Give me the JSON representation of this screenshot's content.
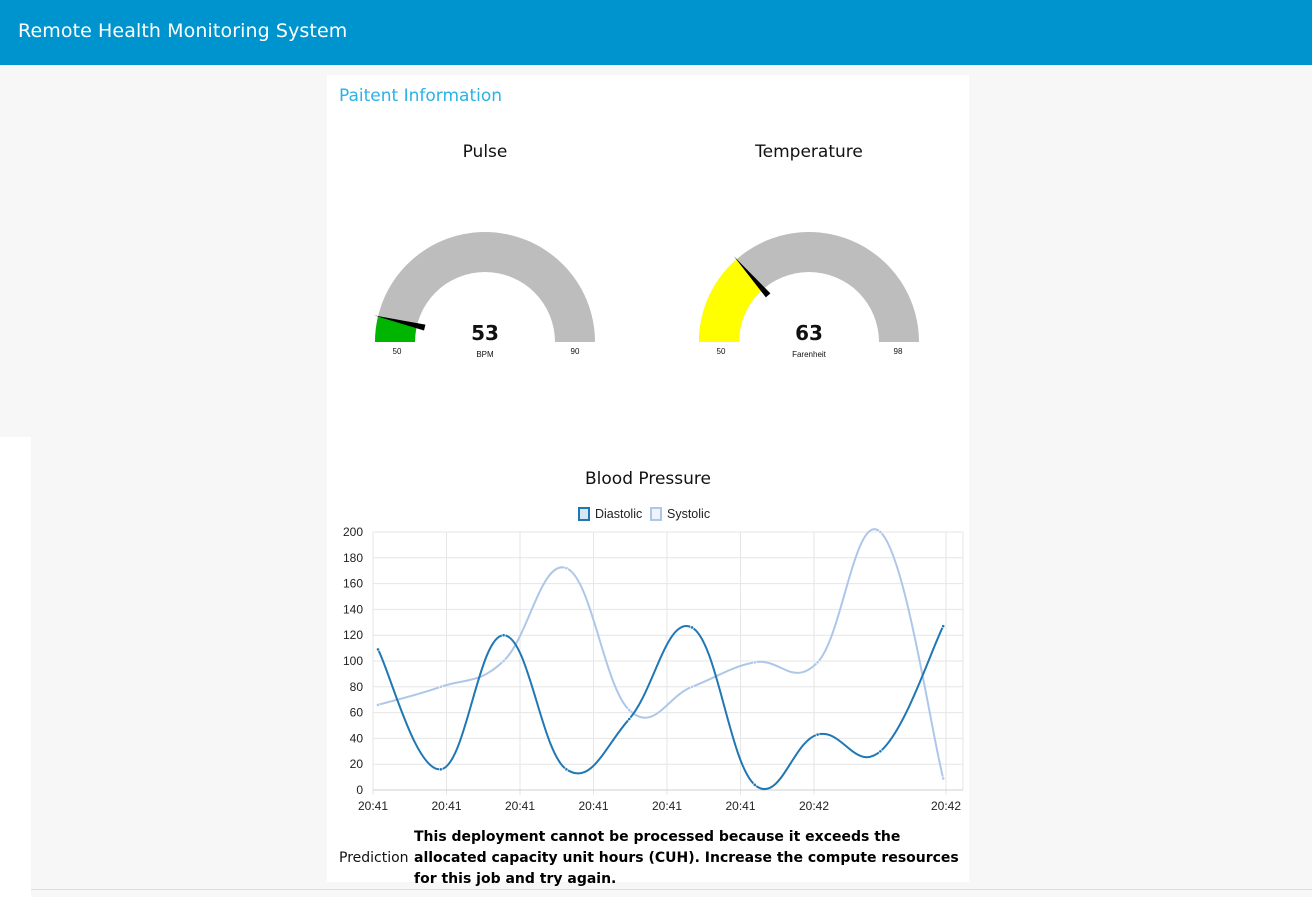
{
  "header": {
    "title": "Remote Health Monitoring System"
  },
  "card": {
    "title": "Paitent Information"
  },
  "gauges": [
    {
      "label": "Pulse",
      "value": 53,
      "min": 50,
      "max": 90,
      "unit": "BPM",
      "fill_color": "#00b500",
      "track_color": "#bdbdbd"
    },
    {
      "label": "Temperature",
      "value": 63,
      "min": 50,
      "max": 98,
      "unit": "Farenheit",
      "fill_color": "#ffff00",
      "track_color": "#bdbdbd"
    }
  ],
  "chart_data": {
    "type": "line",
    "title": "Blood Pressure",
    "xlabel": "",
    "ylabel": "",
    "ylim": [
      0,
      200
    ],
    "yticks": [
      0,
      20,
      40,
      60,
      80,
      100,
      120,
      140,
      160,
      180,
      200
    ],
    "xtick_labels": [
      "20:41",
      "20:41",
      "20:41",
      "20:41",
      "20:41",
      "20:41",
      "20:42",
      "20:42"
    ],
    "legend_position": "top-center",
    "grid": true,
    "series": [
      {
        "name": "Diastolic",
        "color": "#1f77b4",
        "values": [
          109,
          16,
          120,
          16,
          55,
          126,
          4,
          43,
          30,
          127
        ]
      },
      {
        "name": "Systolic",
        "color": "#aec7e8",
        "values": [
          66,
          80,
          100,
          172,
          62,
          80,
          99,
          99,
          200,
          9
        ]
      }
    ]
  },
  "prediction": {
    "label": "Prediction",
    "text": "This deployment cannot be processed because it exceeds the allocated capacity unit hours (CUH). Increase the compute resources for this job and try again."
  }
}
